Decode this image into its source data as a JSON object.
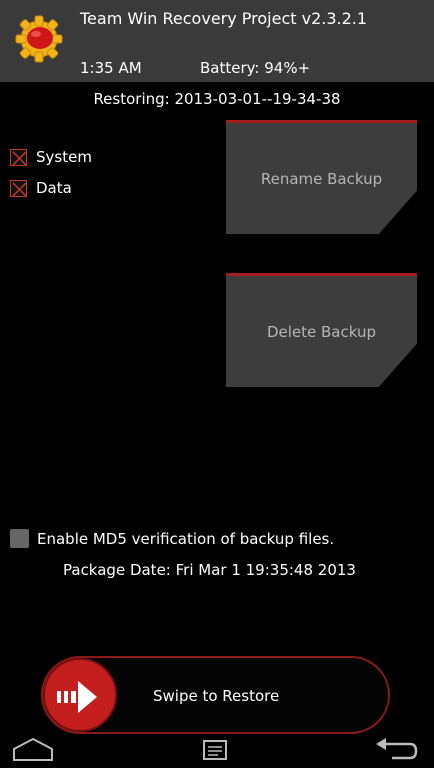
{
  "header": {
    "title": "Team Win Recovery Project  v2.3.2.1",
    "time": "1:35 AM",
    "battery": "Battery: 94%+"
  },
  "restore": {
    "status": "Restoring: 2013-03-01--19-34-38"
  },
  "partitions": [
    {
      "label": "System",
      "checked": true
    },
    {
      "label": "Data",
      "checked": true
    }
  ],
  "buttons": {
    "rename": "Rename Backup",
    "delete": "Delete Backup"
  },
  "options": {
    "md5_label": "Enable MD5 verification of backup files.",
    "md5_checked": false,
    "package_date": "Package Date: Fri Mar  1 19:35:48 2013"
  },
  "swipe": {
    "label": "Swipe to Restore"
  },
  "nav": {
    "home_icon": "home-icon",
    "console_icon": "console-icon",
    "back_icon": "back-icon"
  },
  "colors": {
    "accent": "#a51c1c",
    "header_bg": "#3a3a3a",
    "button_bg": "#3d3d3d"
  }
}
